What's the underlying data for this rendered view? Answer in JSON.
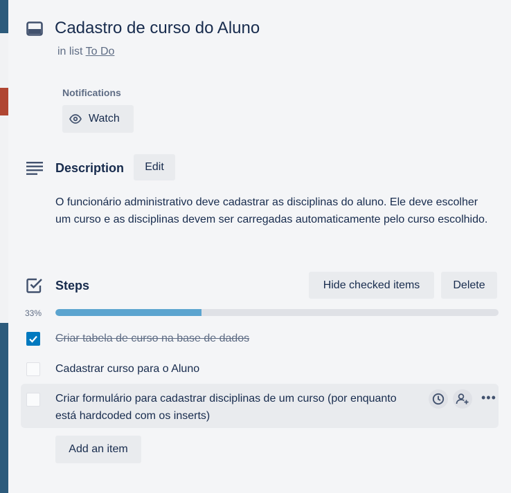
{
  "card": {
    "title": "Cadastro de curso do Aluno",
    "list_prefix": "in list",
    "list_name": "To Do"
  },
  "notifications": {
    "label": "Notifications",
    "watch_label": "Watch"
  },
  "description": {
    "heading": "Description",
    "edit_label": "Edit",
    "text": "O funcionário administrativo deve cadastrar as disciplinas do aluno. Ele deve escolher um curso e as disciplinas devem ser carregadas automaticamente pelo curso escolhido."
  },
  "steps": {
    "heading": "Steps",
    "hide_checked_label": "Hide checked items",
    "delete_label": "Delete",
    "progress_label": "33%",
    "progress_value": 0.33,
    "items": [
      {
        "text": "Criar tabela de curso na base de dados",
        "checked": true
      },
      {
        "text": "Cadastrar curso para o Aluno",
        "checked": false
      },
      {
        "text": "Criar formulário para cadastrar disciplinas de um curso (por enquanto está hardcoded com os inserts)",
        "checked": false
      }
    ],
    "add_item_label": "Add an item"
  },
  "colors": {
    "accent": "#0079bf",
    "progress": "#5ba4cf"
  },
  "icons": {
    "card": "card-icon",
    "watch": "eye-icon",
    "description": "description-lines-icon",
    "steps": "checklist-icon",
    "due": "clock-icon",
    "assign": "add-member-icon",
    "more": "more-dots-icon"
  }
}
